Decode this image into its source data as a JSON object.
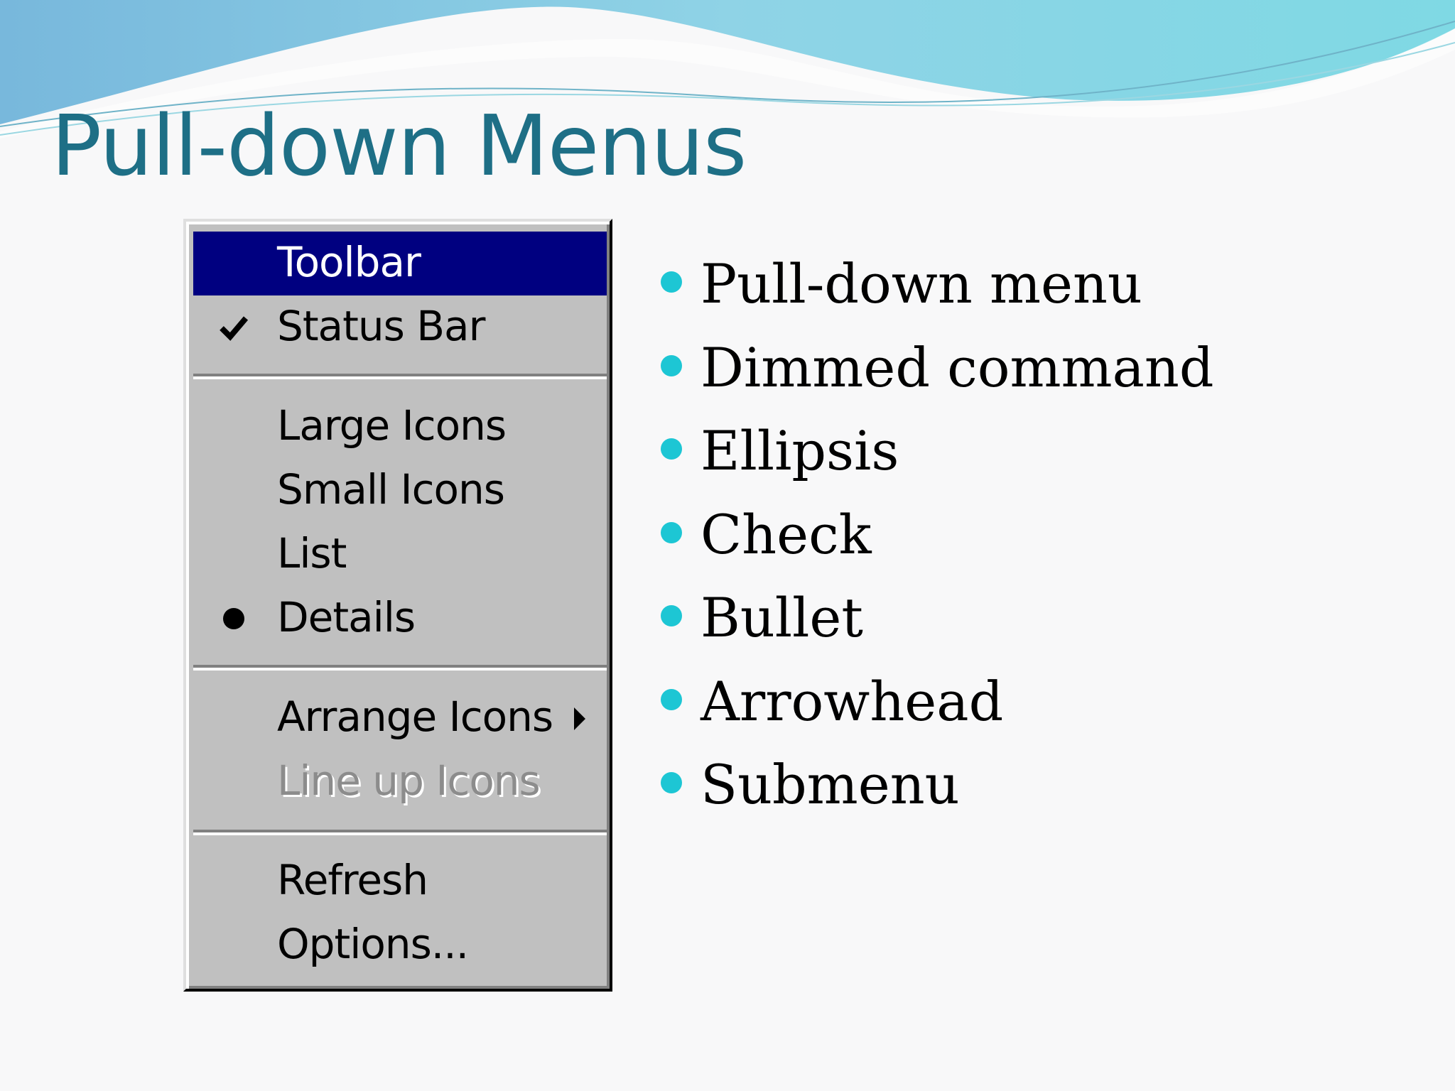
{
  "slide": {
    "title": "Pull-down Menus"
  },
  "menu": {
    "items": [
      {
        "label": "Toolbar",
        "state": "selected",
        "mark": ""
      },
      {
        "label": "Status Bar",
        "state": "normal",
        "mark": "check-icon"
      },
      {
        "label": "Large Icons",
        "state": "normal",
        "mark": ""
      },
      {
        "label": "Small Icons",
        "state": "normal",
        "mark": ""
      },
      {
        "label": "List",
        "state": "normal",
        "mark": ""
      },
      {
        "label": "Details",
        "state": "normal",
        "mark": "radio-bullet-icon"
      },
      {
        "label": "Arrange Icons",
        "state": "normal",
        "mark": "",
        "submenu": true
      },
      {
        "label": "Line up Icons",
        "state": "dimmed",
        "mark": ""
      },
      {
        "label": "Refresh",
        "state": "normal",
        "mark": ""
      },
      {
        "label": "Options...",
        "state": "normal",
        "mark": ""
      }
    ]
  },
  "bullets": [
    "Pull-down menu",
    "Dimmed command",
    "Ellipsis",
    "Check",
    "Bullet",
    "Arrowhead",
    "Submenu"
  ],
  "colors": {
    "title": "#1e6f86",
    "menu_background": "#c0c0c0",
    "selection": "#000080",
    "bullet": "#1dc6d4",
    "dimmed_text": "#8c8c8c"
  }
}
